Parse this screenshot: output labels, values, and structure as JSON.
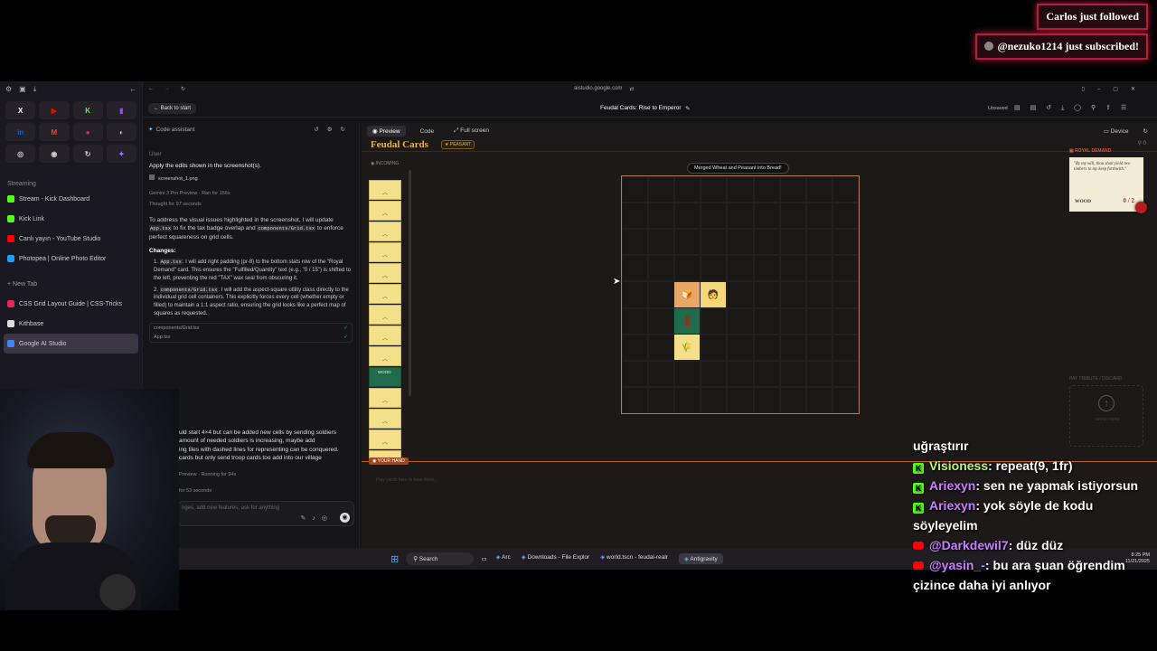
{
  "alerts": {
    "follow": "Carlos just followed",
    "subscribe": "@nezuko1214 just subscribed!"
  },
  "sidebar": {
    "section_streaming": "Streaming",
    "tabs": [
      {
        "label": "Stream - Kick Dashboard",
        "color": "#53fc18"
      },
      {
        "label": "Kick Link",
        "color": "#53fc18"
      },
      {
        "label": "Canlı yayın - YouTube Studio",
        "color": "#ff0000"
      },
      {
        "label": "Photopea | Online Photo Editor",
        "color": "#18a0fb"
      }
    ],
    "new_tab": "+ New Tab",
    "tabs2": [
      {
        "label": "CSS Grid Layout Guide | CSS-Tricks",
        "color": "#e2285e"
      },
      {
        "label": "Kithbase",
        "color": "#dddddd"
      },
      {
        "label": "Google AI Studio",
        "color": "#4285f4"
      }
    ]
  },
  "browser": {
    "url": "aistudio.google.com",
    "back_button": "Back to start",
    "project_title": "Feudal Cards: Rise to Emperor",
    "unsaved": "Unsaved"
  },
  "chat": {
    "code_assistant": "Code assistant",
    "user_label": "User",
    "user_message": "Apply the edits shown in the screenshot(s).",
    "attachment": "screenshot_1.png",
    "model_info": "Gemini 3 Pro Preview · Ran for 156s",
    "thought": "Thought for 97 seconds",
    "intro": "To address the visual issues highlighted in the screenshot, I will update",
    "intro_code1": "App.tsx",
    "intro_mid": "to fix the tax badge overlap and",
    "intro_code2": "components/Grid.tsx",
    "intro_end": "to enforce perfect squareness on grid cells.",
    "changes": "Changes:",
    "change1_code": "App.tsx",
    "change1": ": I will add right padding (pr-8) to the bottom stats row of the \"Royal Demand\" card. This ensures the \"Fulfilled/Quantity\" text (e.g., \"0 / 15\") is shifted to the left, preventing the red \"TAX\" wax seal from obscuring it.",
    "change2_code": "components/Grid.tsx",
    "change2": ": I will add the aspect-square utility class directly to the individual grid cell containers. This explicitly forces every cell (whether empty or filled) to maintain a 1:1 aspect ratio, ensuring the grid looks like a perfect map of squares as requested.",
    "file1": "components/Grid.tsx",
    "file2": "App.tsx",
    "user2_line1": "uld start 4×4 but can be added new cells by sending soldiers",
    "user2_line2": "amount of needed soldiers is increasing, maybe add",
    "user2_line3": "ing tiles with dashed lines for representing can be conquered.",
    "user2_line4": "cards but only send troop cards too add into our village",
    "running": "Preview · Running for 94s",
    "thought2": "for 53 seconds",
    "input_placeholder": "nges, add new features, ask for anything"
  },
  "preview": {
    "tab_preview": "Preview",
    "tab_code": "Code",
    "tab_fullscreen": "Full screen",
    "device": "Device",
    "game_title": "Feudal Cards",
    "rank_badge": "PEASANT",
    "incoming_label": "INCOMING",
    "toast": "Merged Wheat and Peasant into Bread!",
    "wood_card": "WOOD",
    "your_hand": "YOUR HAND",
    "hand_placeholder": "Play cards here to hear them...",
    "royal_demand": "ROYAL DEMAND",
    "demand_quote": "\"By my will, thou shalt yield two timbers to my keep forthwith.\"",
    "demand_item": "WOOD",
    "demand_progress": "0 / 2",
    "tribute": "PAY TRIBUTE / DISCARD",
    "drag_here": "DRAG HERE",
    "counter": "0"
  },
  "taskbar": {
    "search": "Search",
    "apps": [
      "Arc",
      "Downloads - File Explor",
      "world.tscn - feudal-realr",
      "Antigravity"
    ],
    "time": "8:25 PM",
    "date": "11/21/2025"
  },
  "stream_chat": [
    {
      "platform": "none",
      "user": "",
      "text": "uğraştırır",
      "color": "#ffffff"
    },
    {
      "platform": "kick",
      "user": "Visioness",
      "text": ": repeat(9, 1fr)",
      "color": "#b6f27a"
    },
    {
      "platform": "kick",
      "user": "Ariexyn",
      "text": ": sen ne yapmak istiyorsun",
      "color": "#c77dff"
    },
    {
      "platform": "kick",
      "user": "Ariexyn",
      "text": ": yok söyle de kodu söyleyelim",
      "color": "#c77dff"
    },
    {
      "platform": "youtube",
      "user": "@Darkdewil7",
      "text": ": düz düz",
      "color": "#c77dff"
    },
    {
      "platform": "youtube",
      "user": "@yasin_-",
      "text": ": bu ara şuan öğrendim çizince daha iyi anlıyor",
      "color": "#c77dff"
    }
  ]
}
